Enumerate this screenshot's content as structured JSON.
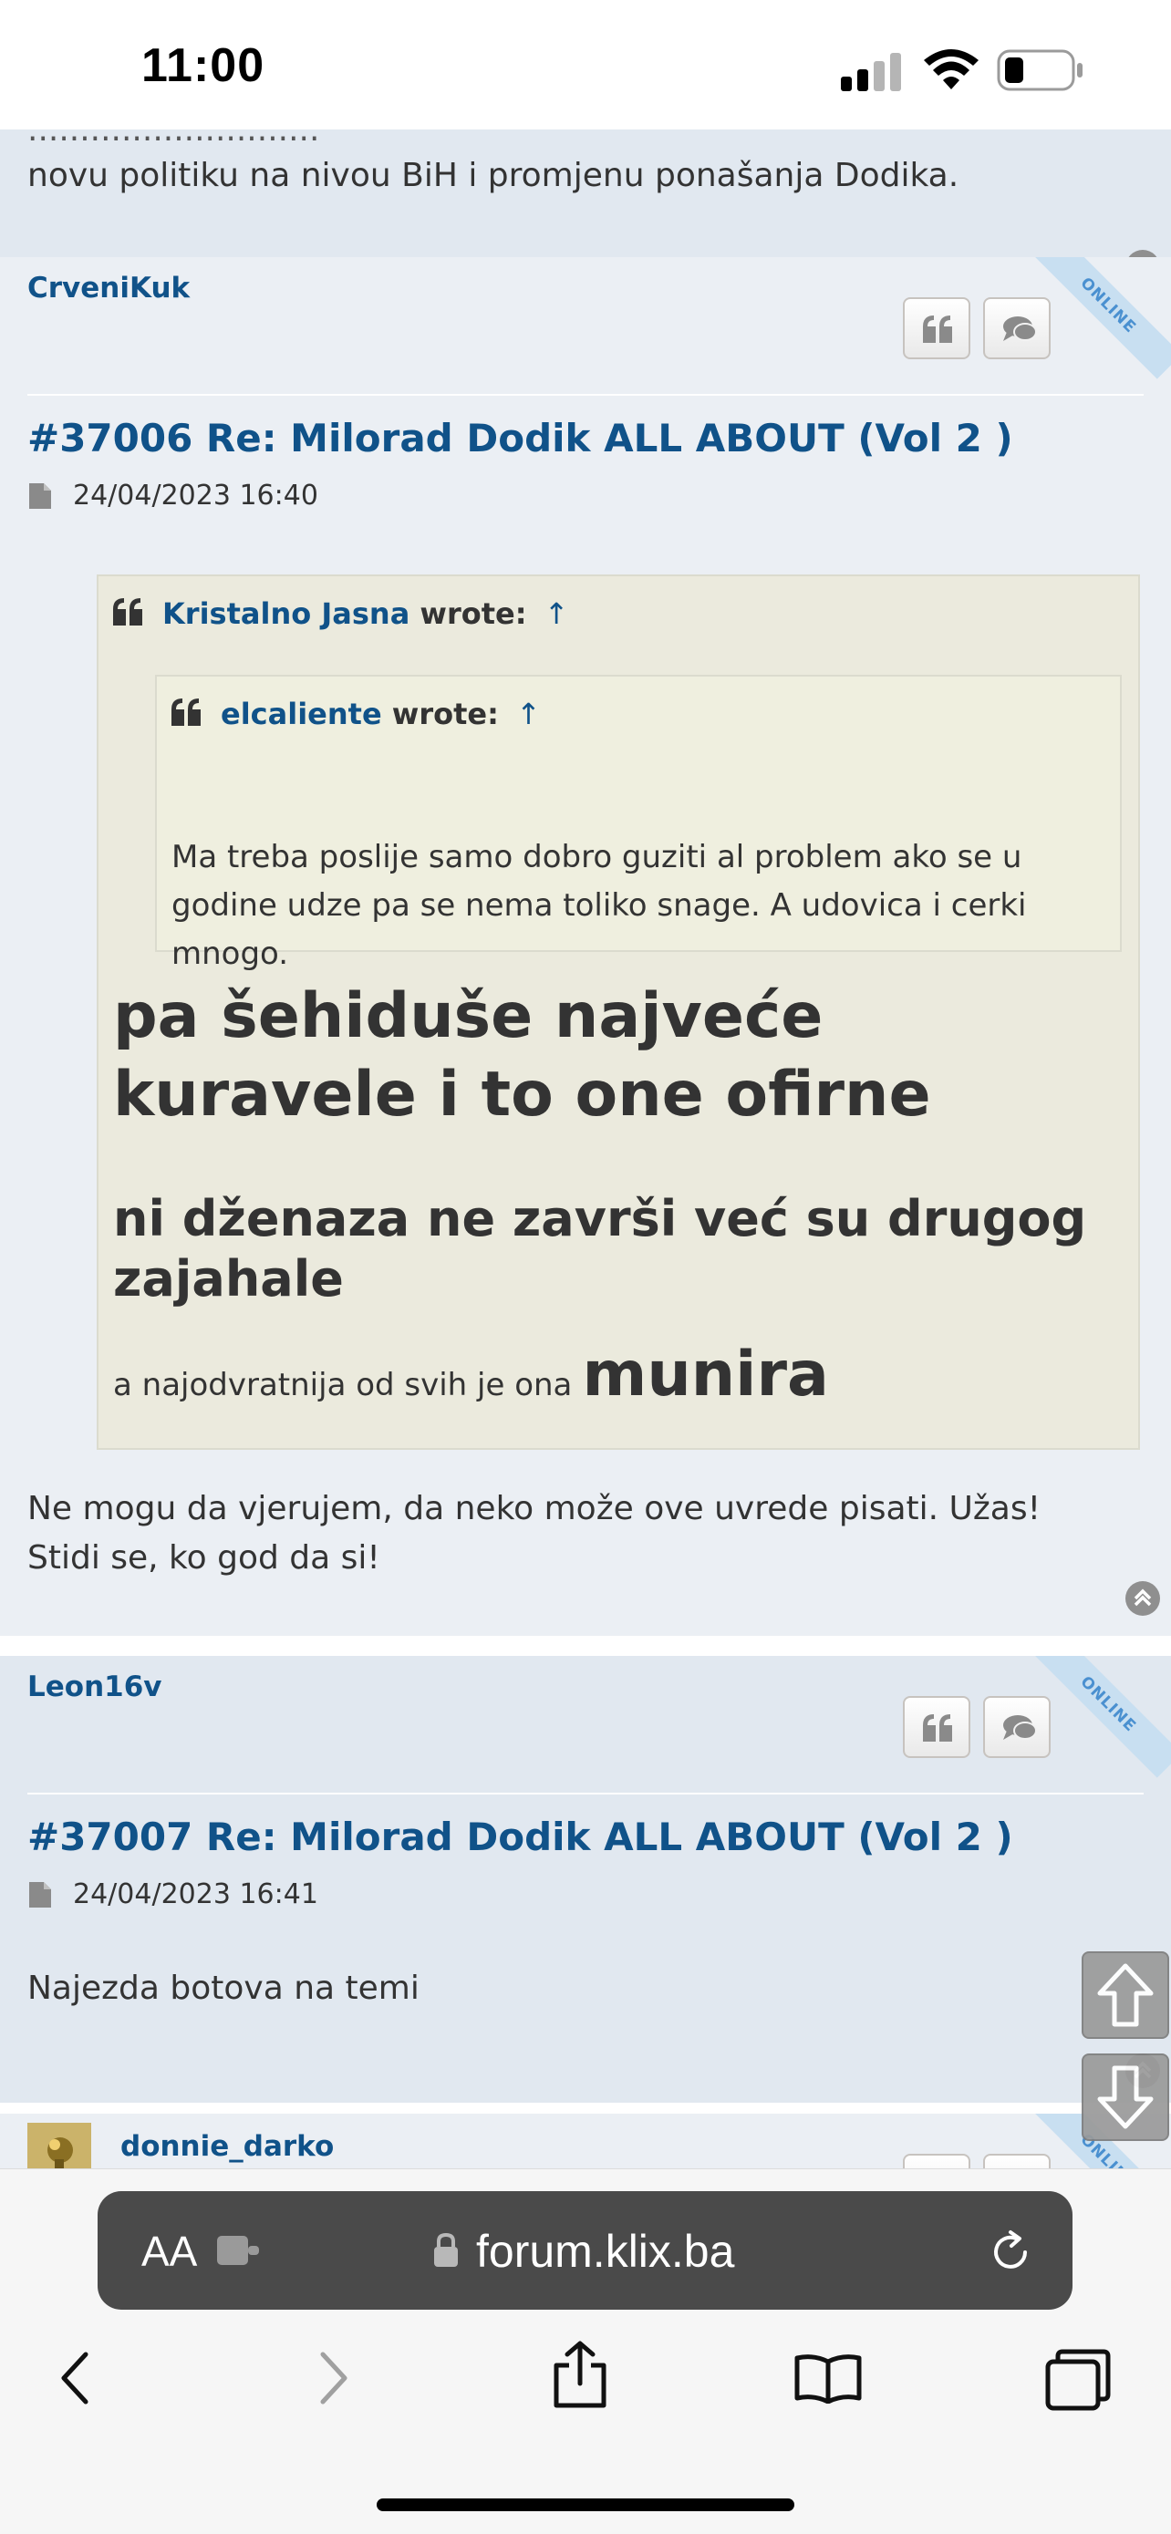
{
  "status_bar": {
    "time": "11:00",
    "icons": [
      "cellular-signal-icon",
      "wifi-icon",
      "battery-icon"
    ]
  },
  "previous_post": {
    "tail_text": "novu politiku na nivou BiH i promjenu ponašanja Dodika."
  },
  "post1": {
    "username": "CrveniKuk",
    "online_badge": "ONLINE",
    "title": "#37006 Re: Milorad Dodik ALL ABOUT (Vol 2 )",
    "date": "24/04/2023 16:40",
    "outer_quote": {
      "author": "Kristalno Jasna",
      "wrote": "wrote:",
      "arrow": "↑",
      "inner_quote": {
        "author": "elcaliente",
        "wrote": "wrote:",
        "arrow": "↑",
        "text": "Ma treba poslije samo dobro guziti al problem ako se u godine udze pa se nema toliko snage. A udovica i cerki mnogo."
      },
      "line1": "pa šehiduše najveće kuravele i to one ofirne",
      "line2": "ni dženaza ne završi već su drugog zajahale",
      "line3_small": "a najodvratnija od svih je ona",
      "line3_big": "munira"
    },
    "body": "Ne mogu da vjerujem, da neko može ove uvrede pisati. Užas! Stidi se, ko god da si!"
  },
  "post2": {
    "username": "Leon16v",
    "online_badge": "ONLINE",
    "title": "#37007 Re: Milorad Dodik ALL ABOUT (Vol 2 )",
    "date": "24/04/2023 16:41",
    "body": "Najezda botova na temi"
  },
  "post3": {
    "username": "donnie_darko"
  },
  "browser": {
    "text_size_label": "AA",
    "url": "forum.klix.ba"
  },
  "colors": {
    "link": "#105289",
    "post_bg_a": "#e1e8f0",
    "post_bg_b": "#ebeff4",
    "quote_bg": "#ebeadd"
  }
}
